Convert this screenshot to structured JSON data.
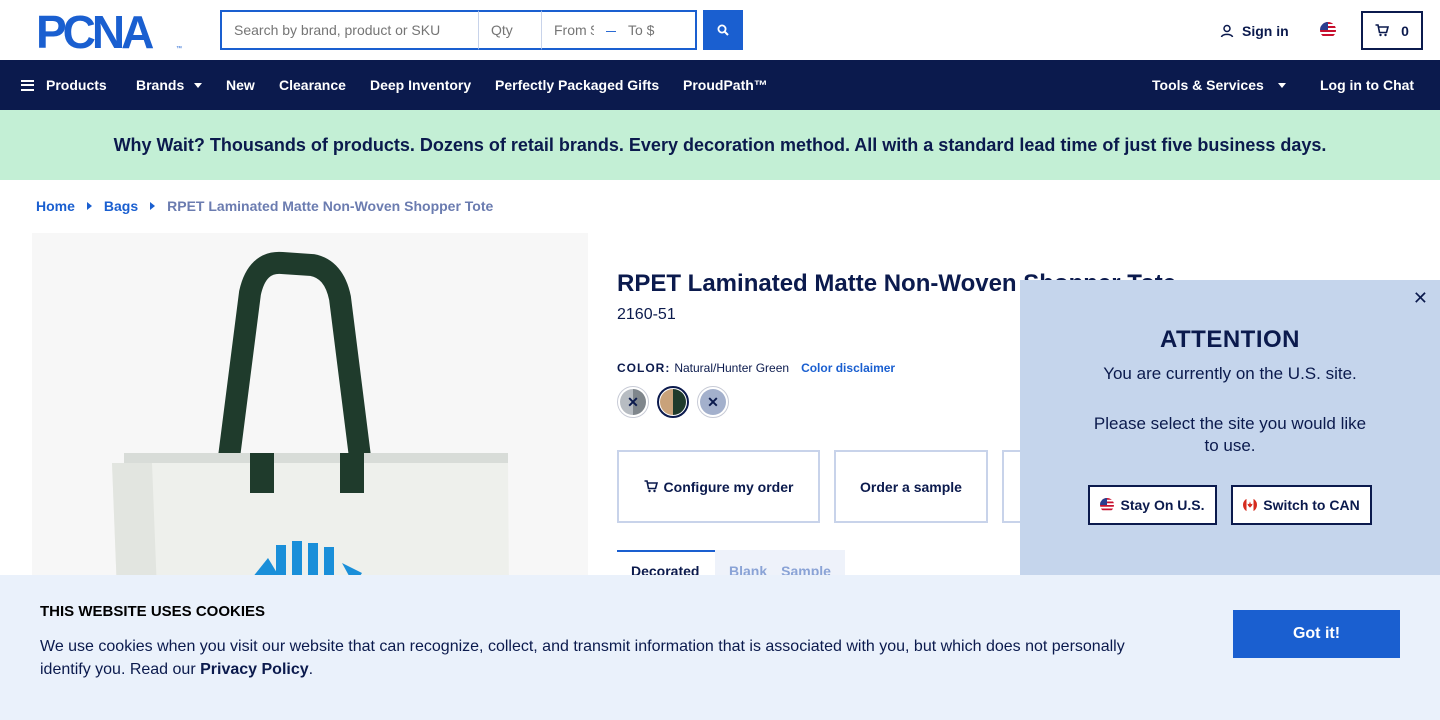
{
  "header": {
    "logo_text": "PCNA",
    "search": {
      "placeholder": "Search by brand, product or SKU",
      "qty_placeholder": "Qty",
      "from_placeholder": "From $",
      "to_placeholder": "To $"
    },
    "signin_label": "Sign in",
    "cart_count": "0"
  },
  "nav": {
    "products": "Products",
    "brands": "Brands",
    "new": "New",
    "clearance": "Clearance",
    "deep_inventory": "Deep Inventory",
    "gifts": "Perfectly Packaged Gifts",
    "proudpath": "ProudPath™",
    "tools": "Tools & Services",
    "chat": "Log in to Chat"
  },
  "promo": "Why Wait? Thousands of products. Dozens of retail brands. Every decoration method. All with a standard lead time of just five business days.",
  "breadcrumb": {
    "home": "Home",
    "bags": "Bags",
    "current": "RPET Laminated Matte Non-Woven Shopper Tote"
  },
  "product": {
    "title": "RPET Laminated Matte Non-Woven Shopper Tote",
    "sku": "2160-51",
    "color_label": "COLOR:",
    "color_value": "Natural/Hunter Green",
    "color_disclaimer": "Color disclaimer",
    "configure_label": "Configure my order",
    "sample_label": "Order a sample",
    "tabs": [
      "Decorated",
      "Blank",
      "Sample"
    ]
  },
  "attention": {
    "title": "ATTENTION",
    "message1": "You are currently on the U.S. site.",
    "message2": "Please select the site you would like to use.",
    "stay_label": "Stay On U.S.",
    "switch_label": "Switch to CAN"
  },
  "cookie": {
    "title": "THIS WEBSITE USES COOKIES",
    "text": "We use cookies when you visit our website that can recognize, collect, and transmit information that is associated with you, but which does not personally identify you. Read our",
    "privacy": "Privacy Policy",
    "button": "Got it!"
  },
  "colors": {
    "navy": "#0b1a4d",
    "accent": "#1a5fd0",
    "promo_bg": "#c3efd5",
    "attention_bg": "#c5d5ec",
    "cookie_bg": "#eaf1fb",
    "swatch_gray": "#9aa0a6",
    "swatch_natural": "#c9a27a",
    "swatch_hunter_green": "#1f3b2c",
    "swatch_blue_gray": "#8fa0bf"
  }
}
